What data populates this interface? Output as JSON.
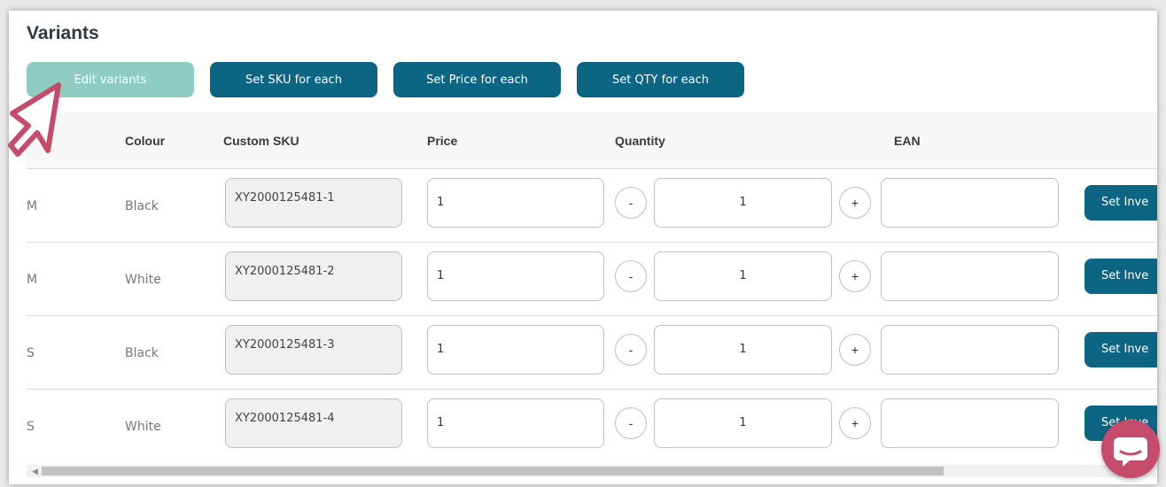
{
  "section_title": "Variants",
  "buttons": {
    "edit_variants": "Edit variants",
    "set_sku": "Set SKU for each",
    "set_price": "Set Price for each",
    "set_qty": "Set QTY for each"
  },
  "table": {
    "headers": {
      "colour": "Colour",
      "custom_sku": "Custom SKU",
      "price": "Price",
      "quantity": "Quantity",
      "ean": "EAN"
    },
    "rows": [
      {
        "size": "M",
        "colour": "Black",
        "sku": "XY2000125481-1",
        "price": "1",
        "qty": "1",
        "ean": "",
        "action": "Set Inve"
      },
      {
        "size": "M",
        "colour": "White",
        "sku": "XY2000125481-2",
        "price": "1",
        "qty": "1",
        "ean": "",
        "action": "Set Inve"
      },
      {
        "size": "S",
        "colour": "Black",
        "sku": "XY2000125481-3",
        "price": "1",
        "qty": "1",
        "ean": "",
        "action": "Set Inve"
      },
      {
        "size": "S",
        "colour": "White",
        "sku": "XY2000125481-4",
        "price": "1",
        "qty": "1",
        "ean": "",
        "action": "Set Inve"
      }
    ],
    "minus": "-",
    "plus": "+"
  },
  "colors": {
    "primary": "#0c6582",
    "primary_light": "#8fcdc2",
    "chat": "#c64c6c",
    "cursor": "#c64c6c"
  },
  "icons": {
    "cursor": "pointer-cursor-icon",
    "chat": "chat-bubble-icon",
    "scroll_left": "caret-left-icon"
  }
}
